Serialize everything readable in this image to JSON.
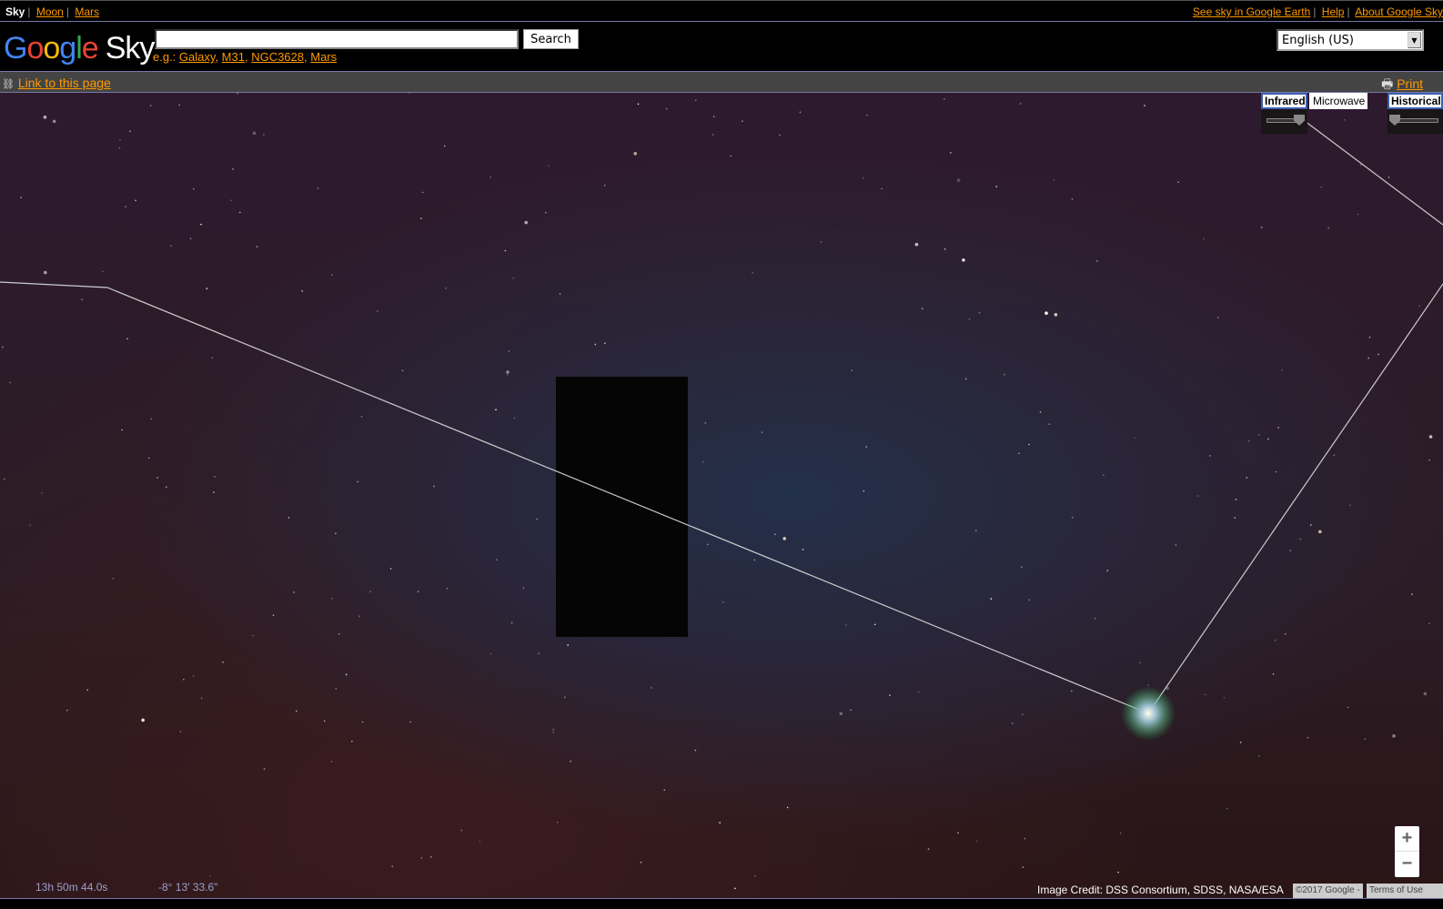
{
  "topbar": {
    "current": "Sky",
    "links": [
      "Moon",
      "Mars"
    ],
    "right_links": [
      "See sky in Google Earth",
      "Help",
      "About Google Sky"
    ]
  },
  "header": {
    "logo_google": "Google",
    "logo_sky": "Sky",
    "search_value": "",
    "search_button": "Search",
    "eg_label": "e.g.:",
    "examples": [
      "Galaxy",
      "M31",
      "NGC3628",
      "Mars"
    ],
    "language": "English (US)"
  },
  "linkbar": {
    "link": "Link to this page",
    "print": "Print"
  },
  "layers": {
    "buttons": [
      "Infrared",
      "Microwave",
      "Historical"
    ],
    "infrared_opacity": 0.85,
    "historical_opacity": 0.0
  },
  "status": {
    "ra": "13h 50m 44.0s",
    "dec": "-8° 13' 33.6\"",
    "credit": "Image Credit: DSS Consortium, SDSS, NASA/ESA",
    "copyright": "©2017 Google -",
    "terms": "Terms of Use"
  },
  "zoom": {
    "in": "+",
    "out": "−"
  },
  "colors": {
    "link": "#ff9900",
    "border": "#7677a8"
  }
}
